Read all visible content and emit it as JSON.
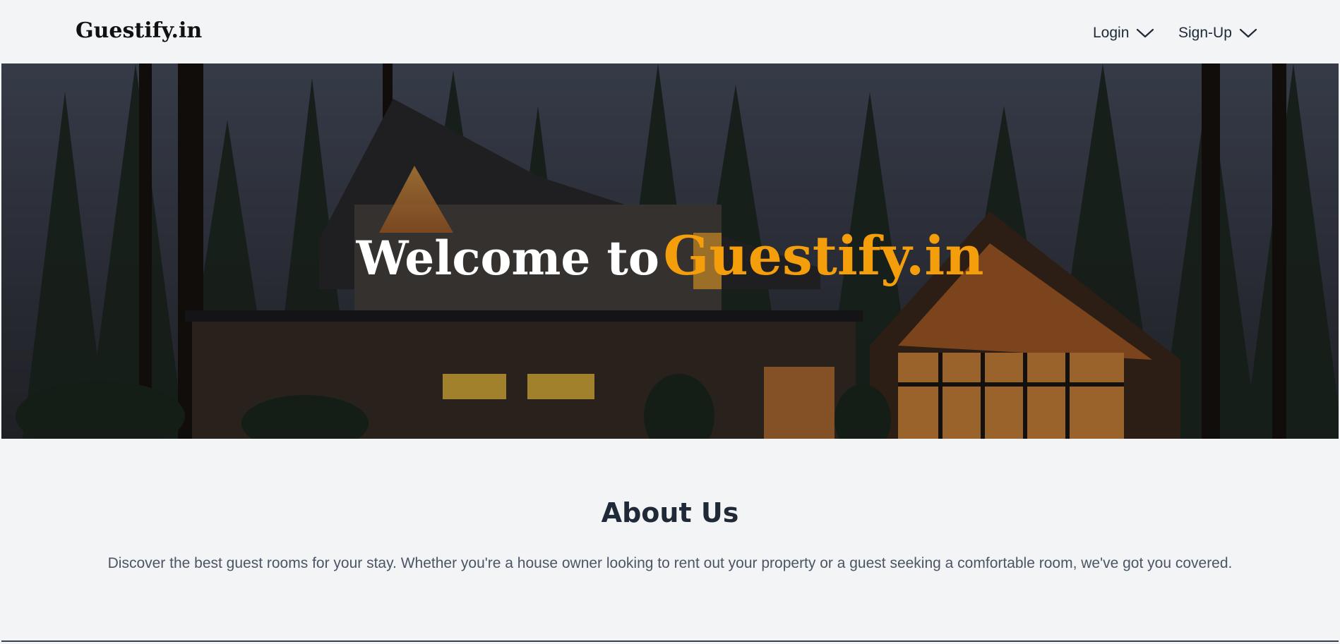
{
  "header": {
    "brand": "Guestify.in",
    "nav": [
      {
        "label": "Login",
        "icon": "chevron-down-icon"
      },
      {
        "label": "Sign-Up",
        "icon": "chevron-down-icon"
      }
    ]
  },
  "hero": {
    "title_lead": "Welcome to",
    "title_accent": "Guestify.in",
    "accent_color": "#f59e0b",
    "image": "cabin-in-pine-forest-at-dusk"
  },
  "about": {
    "title": "About Us",
    "text": "Discover the best guest rooms for your stay. Whether you're a house owner looking to rent out your property or a guest seeking a comfortable room, we've got you covered."
  }
}
